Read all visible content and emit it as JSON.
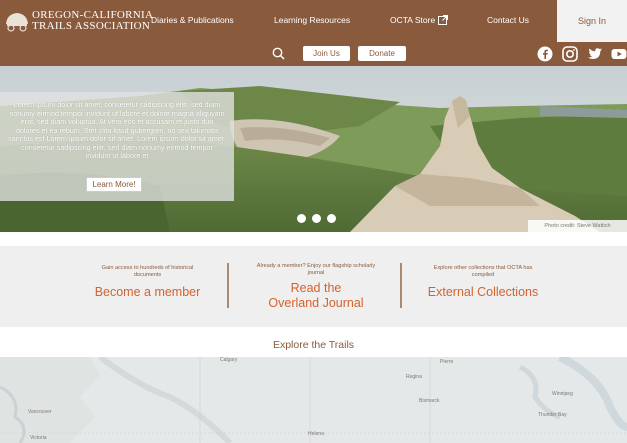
{
  "header": {
    "logo": {
      "line1": "OREGON-CALIFORNIA",
      "line2": "TRAILS ASSOCIATION"
    },
    "nav": [
      {
        "label": "Diaries & Publications"
      },
      {
        "label": "Learning Resources"
      },
      {
        "label": "OCTA Store"
      },
      {
        "label": "Contact Us"
      }
    ],
    "signin_label": "Sign In",
    "join_label": "Join Us",
    "donate_label": "Donate"
  },
  "hero": {
    "text": "Lorem ipsum dolor sit amet, consetetur sadipscing elitr, sed diam nonumy eirmod tempor invidunt ut labore et dolore magna aliquyam erat, sed diam voluptua. At vero eos et accusam et justo duo dolores et ea rebum. Stet clita kasd gubergren, no sea takimata sanctus est Lorem ipsum dolor sit amet. Lorem ipsum dolor sit amet, consetetur sadipscing elitr, sed diam nonumy eirmod tempor invidunt ut labore et",
    "button_label": "Learn More!",
    "credit": "Photo credit: Steve Wattich",
    "slides": 3
  },
  "promos": [
    {
      "small": "Gain access to hundreds of historical documents",
      "title": "Become a member"
    },
    {
      "small": "Already a member? Enjoy our flagship scholarly journal",
      "title_line1": "Read the",
      "title_line2": "Overland Journal"
    },
    {
      "small": "Explore other collections that OCTA has compiled",
      "title": "External Collections"
    }
  ],
  "explore": {
    "title": "Explore the Trails"
  },
  "map": {
    "labels": [
      "Calgary",
      "Regina",
      "Winnipeg",
      "Vancouver",
      "Victoria",
      "Helena",
      "Bismarck",
      "Pierre",
      "Thunder Bay"
    ]
  },
  "colors": {
    "brand_brown": "#8a5a3c",
    "accent_orange": "#d4622d",
    "promo_bg": "#efefef"
  }
}
